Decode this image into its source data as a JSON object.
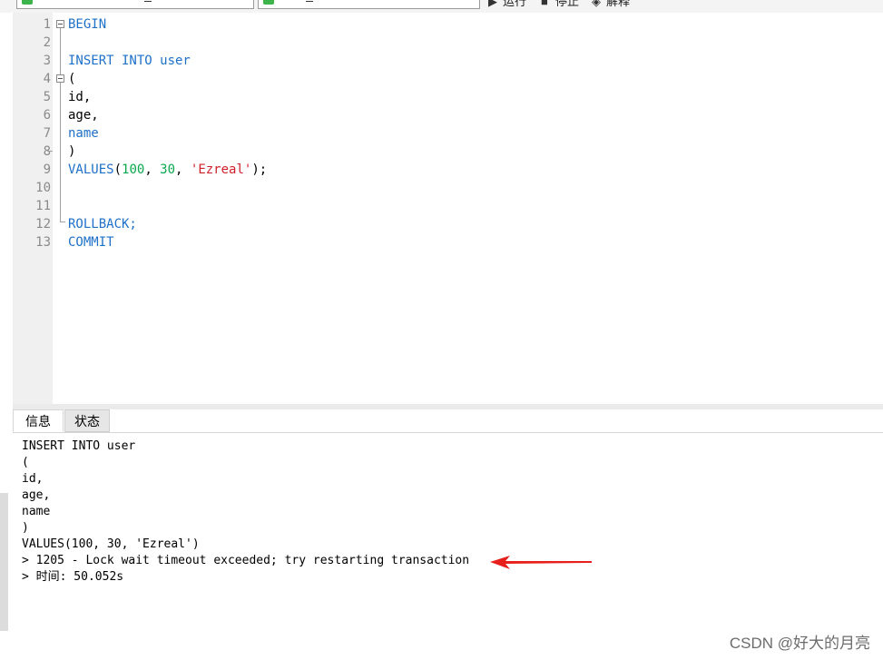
{
  "toolbar": {
    "run_label": "运行",
    "stop_label": "停止",
    "explain_label": "解释"
  },
  "editor": {
    "lines": [
      {
        "n": "1",
        "text": "BEGIN"
      },
      {
        "n": "2",
        "text": ""
      },
      {
        "n": "3",
        "text": "INSERT INTO user"
      },
      {
        "n": "4",
        "text": "("
      },
      {
        "n": "5",
        "text": "id,"
      },
      {
        "n": "6",
        "text": "age,"
      },
      {
        "n": "7",
        "text": "name"
      },
      {
        "n": "8",
        "text": ")"
      },
      {
        "n": "9",
        "text": "VALUES(100, 30, 'Ezreal');"
      },
      {
        "n": "10",
        "text": ""
      },
      {
        "n": "11",
        "text": ""
      },
      {
        "n": "12",
        "text": "ROLLBACK;"
      },
      {
        "n": "13",
        "text": "COMMIT"
      }
    ],
    "tokens": {
      "values_kw": "VALUES",
      "paren_open": "(",
      "num_100": "100",
      "comma1": ", ",
      "num_30": "30",
      "comma2": ", ",
      "str_ezreal": "'Ezreal'",
      "tail": ");"
    }
  },
  "result_tabs": [
    {
      "label": "信息"
    },
    {
      "label": "状态"
    }
  ],
  "messages": [
    "INSERT INTO user",
    "(",
    "id,",
    "age,",
    "name",
    ")",
    "VALUES(100, 30, 'Ezreal')",
    "> 1205 - Lock wait timeout exceeded; try restarting transaction",
    "> 时间: 50.052s"
  ],
  "watermark": "CSDN @好大的月亮",
  "colors": {
    "keyword": "#1e70c8",
    "number": "#0aa84c",
    "string": "#d0202a",
    "arrow": "#e8201c"
  }
}
